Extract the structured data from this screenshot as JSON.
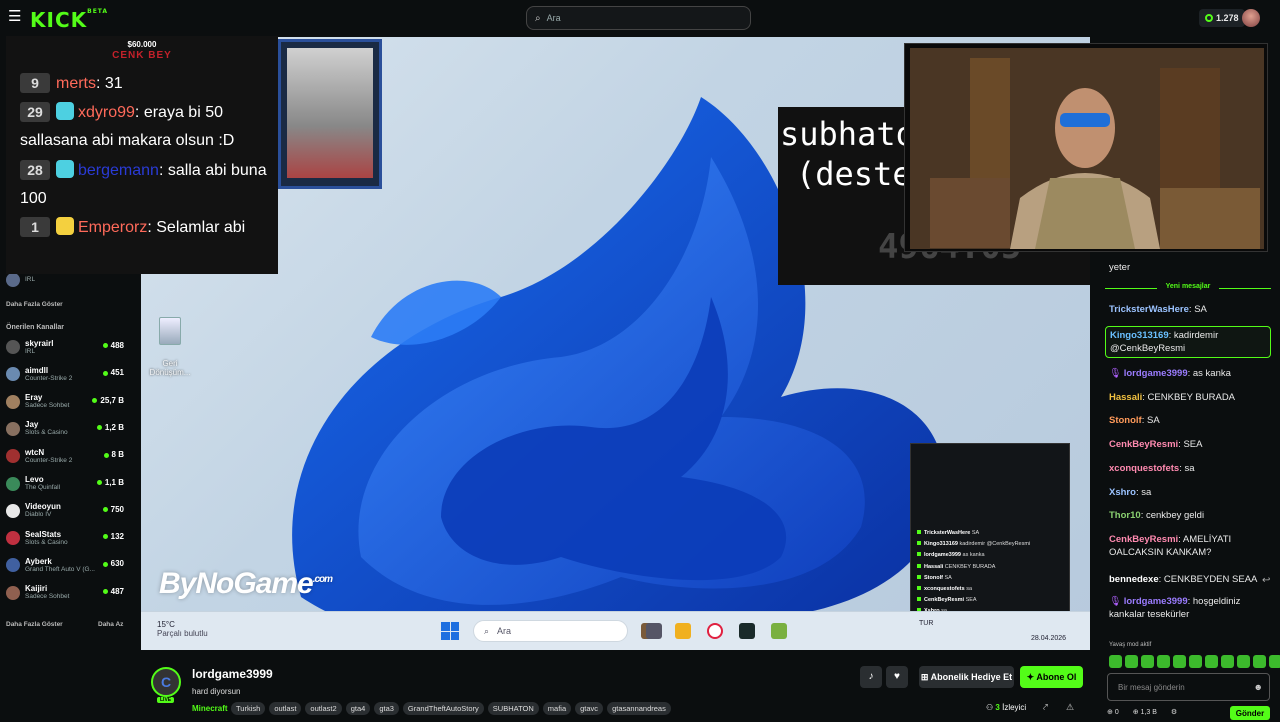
{
  "header": {
    "logo": "KICK",
    "logo_sup": "BETA",
    "search_placeholder": "Ara",
    "points": "1.278"
  },
  "overlay": {
    "amount": "$60.000",
    "title": "CENK BEY",
    "messages": [
      {
        "num": "9",
        "user": "merts",
        "text": " 31",
        "color": "#ff6a5a"
      },
      {
        "num": "29",
        "user": "xdyro99",
        "text": " eraya bi 50 sallasana abi makara olsun :D",
        "color": "#ff6a5a"
      },
      {
        "num": "28",
        "user": "bergemann",
        "text": " salla abi buna 100",
        "color": "#2a3bd6"
      },
      {
        "num": "1",
        "user": "Emperorz",
        "text": " Selamlar abi",
        "color": "#ff6a5a"
      }
    ]
  },
  "sidebar": {
    "followed_top": {
      "name": "...",
      "sub": "IRL"
    },
    "show_more_1": "Daha Fazla Göster",
    "recommended_title": "Önerilen Kanallar",
    "recommended": [
      {
        "name": "skyrairl",
        "game": "IRL",
        "viewers": "488",
        "color": "#555"
      },
      {
        "name": "aimdll",
        "game": "Counter-Strike 2",
        "viewers": "451",
        "color": "#6a8ab0"
      },
      {
        "name": "Eray",
        "game": "Sadece Sohbet",
        "viewers": "25,7 B",
        "color": "#a08060"
      },
      {
        "name": "Jay",
        "game": "Slots & Casino",
        "viewers": "1,2 B",
        "color": "#887060"
      },
      {
        "name": "wtcN",
        "game": "Counter-Strike 2",
        "viewers": "8 B",
        "color": "#a03030"
      },
      {
        "name": "Levo",
        "game": "The Quinfall",
        "viewers": "1,1 B",
        "color": "#3a8a5a"
      },
      {
        "name": "Videoyun",
        "game": "Diablo IV",
        "viewers": "750",
        "color": "#e8e8e8"
      },
      {
        "name": "SealStats",
        "game": "Slots & Casino",
        "viewers": "132",
        "color": "#c03040"
      },
      {
        "name": "Ayberk",
        "game": "Grand Theft Auto V (G...",
        "viewers": "630",
        "color": "#4060a0"
      },
      {
        "name": "Kaijiri",
        "game": "Sadece Sohbet",
        "viewers": "487",
        "color": "#906050"
      }
    ],
    "show_more_2": "Daha Fazla Göster",
    "show_less": "Daha Az"
  },
  "video": {
    "recycle_label": "Geri Dönüşüm...",
    "subhaton_line1": "subhato",
    "subhaton_line2": "(deste",
    "subhaton_counter": "4964.05",
    "brand_watermark": "ByNoGame",
    "brand_suffix": ".com",
    "mini_chat": [
      {
        "user": "TricksterWasHere",
        "text": "SA"
      },
      {
        "user": "Kingo313169",
        "text": "kadirdemir @CenkBeyResmi"
      },
      {
        "user": "lordgame3999",
        "text": "as kanka"
      },
      {
        "user": "Hassali",
        "text": "CENKBEY BURADA"
      },
      {
        "user": "Stonolf",
        "text": "SA"
      },
      {
        "user": "xconquestofets",
        "text": "sa"
      },
      {
        "user": "CenkBeyResmi",
        "text": "SEA"
      },
      {
        "user": "Xshro",
        "text": "sa"
      }
    ],
    "taskbar": {
      "temp": "15°C",
      "weather": "Parçalı bulutlu",
      "search": "Ara",
      "lang": "TUR",
      "date": "28.04.2026"
    }
  },
  "chat": {
    "prev_fragment": "yeter",
    "new_messages_label": "Yeni mesajlar",
    "messages": [
      {
        "user": "TricksterWasHere",
        "text": ": SA",
        "color": "#9bc3ff"
      },
      {
        "user": "Kingo313169",
        "text": ": kadirdemir @CenkBeyResmi",
        "color": "#6ac0ff"
      },
      {
        "user": "lordgame3999",
        "text": ": as kanka",
        "color": "#9b7cff"
      },
      {
        "user": "Hassali",
        "text": ": CENKBEY BURADA",
        "color": "#f0c040"
      },
      {
        "user": "Stonolf",
        "text": ": SA",
        "color": "#ff9a5a"
      },
      {
        "user": "CenkBeyResmi",
        "text": ": SEA",
        "color": "#ff8ab0"
      },
      {
        "user": "xconquestofets",
        "text": ": sa",
        "color": "#ff8ab0"
      },
      {
        "user": "Xshro",
        "text": ": sa",
        "color": "#9bc3ff"
      },
      {
        "user": "Thor10",
        "text": ": cenkbey geldi",
        "color": "#8ad070"
      },
      {
        "user": "CenkBeyResmi",
        "text": ": AMELİYATI OALCAKSIN KANKAM?",
        "color": "#ff8ab0"
      },
      {
        "user": "bennedexe",
        "text": ": CENKBEYDEN SEAA",
        "color": "#ffffff"
      },
      {
        "user": "lordgame3999",
        "text": ": hoşgeldiniz kankalar tesekürler",
        "color": "#9b7cff"
      }
    ],
    "slow_mode": "Yavaş mod aktif",
    "input_placeholder": "Bir mesaj gönderin",
    "points": "0",
    "points2": "1,3 B",
    "send_label": "Gönder"
  },
  "stream_info": {
    "avatar_letter": "C",
    "live": "LIVE",
    "channel": "lordgame3999",
    "title": "hard diyorsun",
    "category": "Minecraft",
    "tags": [
      "Turkish",
      "outlast",
      "outlast2",
      "gta4",
      "gta3",
      "GrandTheftAutoStory",
      "SUBHATON",
      "mafia",
      "gtavc",
      "gtasannandreas"
    ],
    "gift_label": "Abonelik Hediye Et",
    "subscribe_label": "Abone Ol",
    "viewers": "3",
    "viewers_label": "İzleyici"
  },
  "colors": {
    "accent": "#53fc18",
    "bg": "#0b0e0f"
  }
}
